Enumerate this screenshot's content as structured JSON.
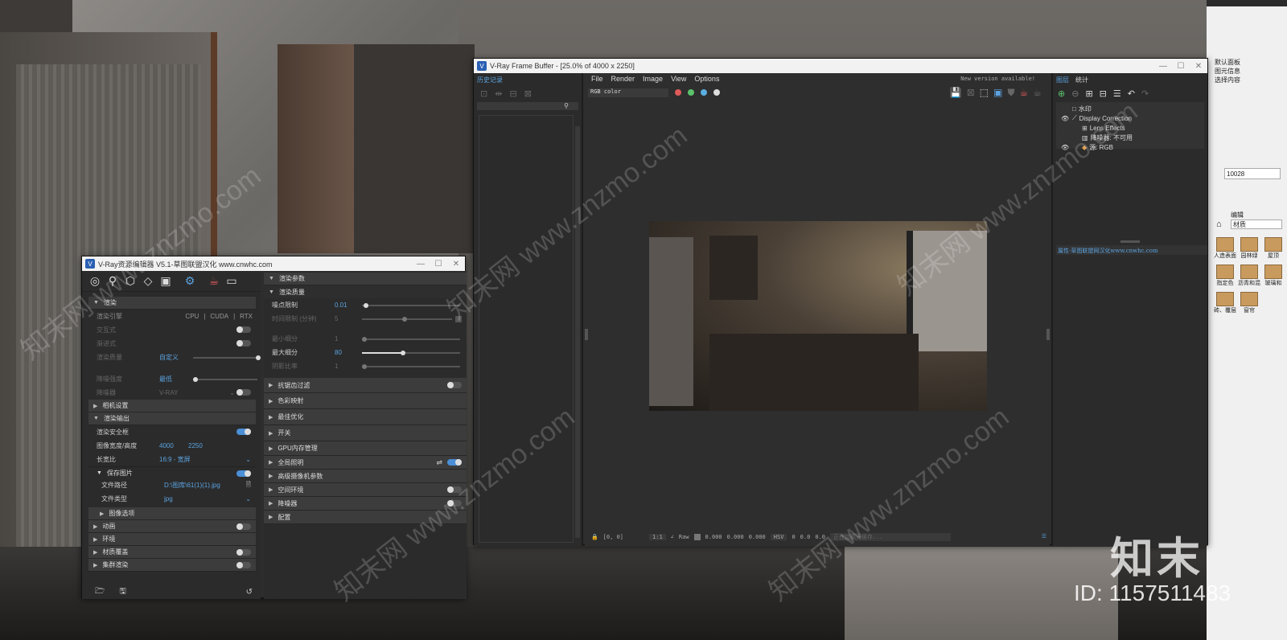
{
  "vfb": {
    "title": "V-Ray Frame Buffer - [25.0% of 4000 x 2250]",
    "history_label": "历史记录",
    "menu": [
      "File",
      "Render",
      "Image",
      "View",
      "Options"
    ],
    "new_version": "New version available!",
    "channel": "RGB color",
    "layers_tab": "图层",
    "stats_tab": "统计",
    "layers": [
      "水印",
      "Display Correction",
      "Lens Effects",
      "降噪器: 不可用",
      "源: RGB"
    ],
    "props_text": "属性-草图联盟网汉化www.cnwhc.com",
    "status_coords": "[0, 0]",
    "status_zoom": "1:1",
    "status_raw": "Raw",
    "status_vals": [
      "0.000",
      "0.000",
      "0.000"
    ],
    "status_hsv": "HSV",
    "status_hsv_vals": [
      "0",
      "0.0",
      "0.0"
    ],
    "status_msg": "正在加载光缓存..."
  },
  "asset_editor": {
    "title": "V-Ray资源编辑器 V5.1-草图联盟汉化 www.cnwhc.com",
    "render_section": "渲染",
    "render_engine_label": "渲染引擎",
    "engines": [
      "CPU",
      "CUDA",
      "RTX"
    ],
    "interactive_label": "交互式",
    "progressive_label": "渐进式",
    "quality_label": "渲染质量",
    "quality_value": "自定义",
    "denoiser_label": "降噪器",
    "denoiser_value": "V-RAY",
    "denoise_label": "降噪强度",
    "denoise_value": "最低",
    "camera_settings": "相机设置",
    "output_section": "渲染输出",
    "safe_frame_label": "渲染安全框",
    "size_label": "图像宽度/高度",
    "width": "4000",
    "height": "2250",
    "ratio_label": "长宽比",
    "ratio_value": "16:9 - 宽屏",
    "save_image": "保存图片",
    "file_path_label": "文件路径",
    "file_path": "D:\\图库\\61(1)(1).jpg",
    "file_type_label": "文件类型",
    "file_type": "jpg",
    "image_options": "图像选项",
    "animation": "动画",
    "environment": "环境",
    "material_override": "材质覆盖",
    "cluster": "集群渲染"
  },
  "render_params": {
    "title": "渲染参数",
    "quality_title": "渲染质量",
    "noise_label": "噪点限制",
    "noise_value": "0.01",
    "time_label": "时间限制 (分钟)",
    "time_value": "5",
    "min_label": "最小细分",
    "min_value": "1",
    "max_label": "最大细分",
    "max_value": "80",
    "shade_label": "阴影比率",
    "shade_value": "1",
    "sections": [
      "抗锯齿过滤",
      "色彩映射",
      "最佳优化",
      "开关",
      "GPU内存管理",
      "全局照明",
      "高级摄像机参数",
      "空间环境",
      "降噪器",
      "配置"
    ]
  },
  "sketchup": {
    "default_panel": "默认面板",
    "entity_info": "图元信息",
    "select_content": "选择内容",
    "number_value": "10028",
    "edit_label": "编辑",
    "material_label": "材质",
    "materials": [
      "人造表面",
      "园林绿",
      "屋顶",
      "指定色",
      "沥青和混",
      "玻璃和",
      "砖、覆层",
      "窗帘"
    ]
  },
  "watermarks": {
    "site": "www.znzmo.com",
    "brand_cn": "知末网",
    "logo_cn": "知末",
    "id_text": "ID: 1157511483"
  }
}
